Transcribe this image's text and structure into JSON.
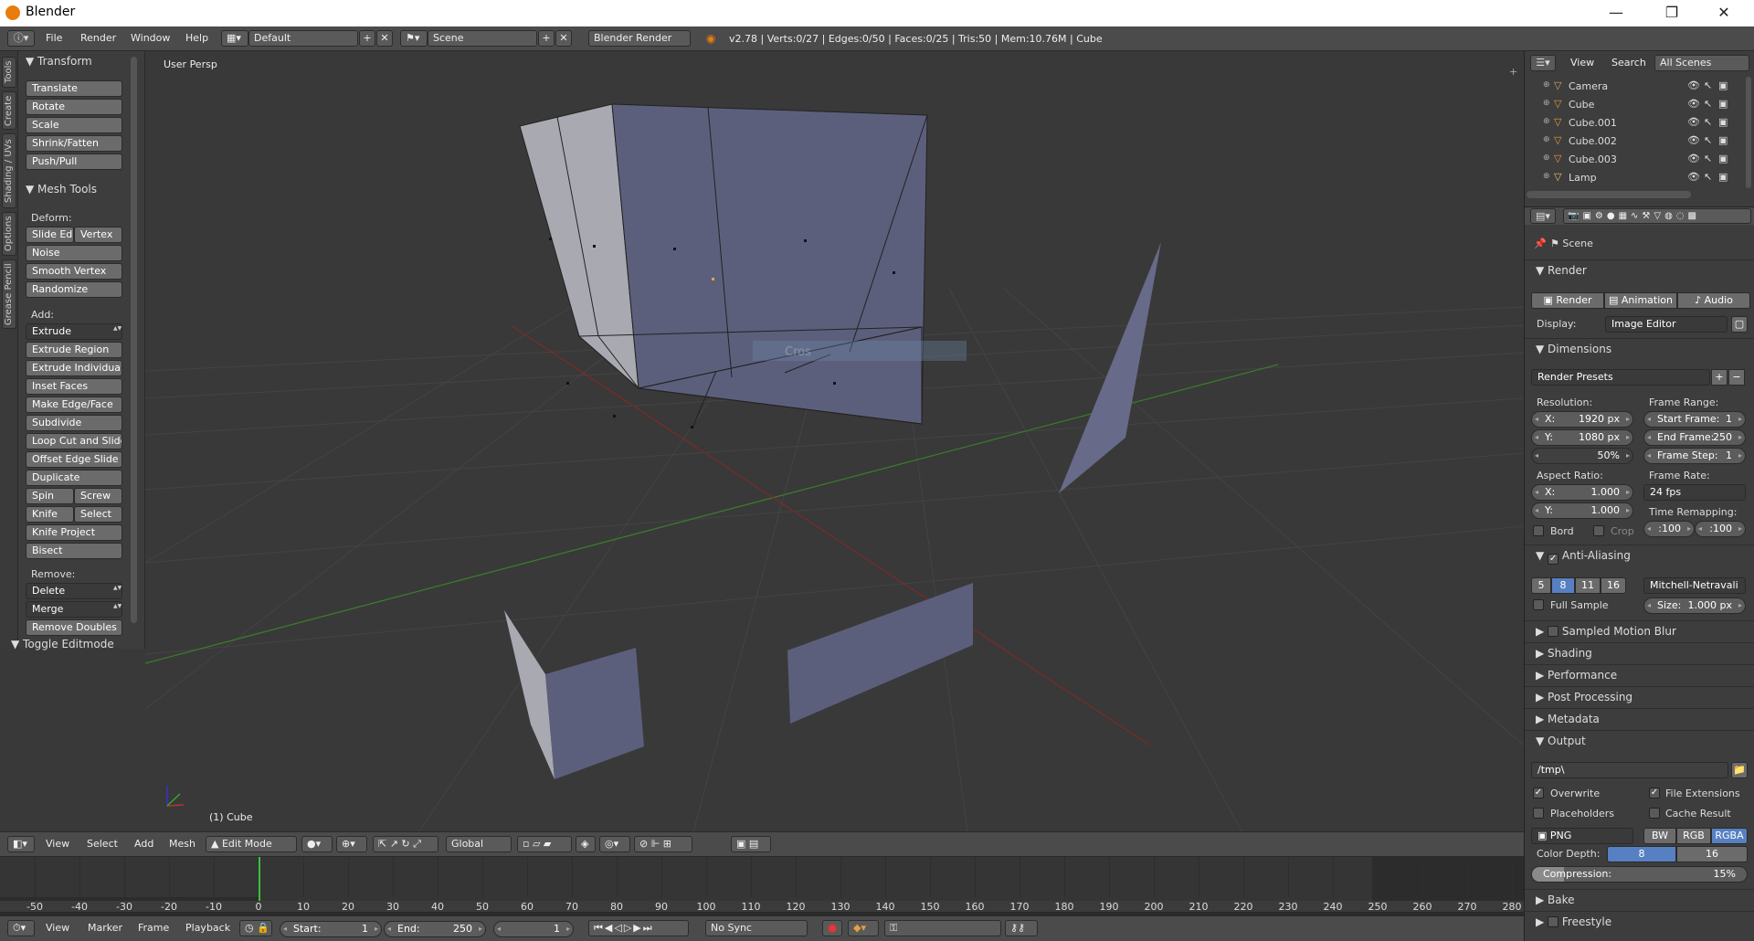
{
  "window": {
    "title": "Blender",
    "minimize": "—",
    "maximize": "❐",
    "close": "✕"
  },
  "infobar": {
    "menus": [
      "File",
      "Render",
      "Window",
      "Help"
    ],
    "layout": "Default",
    "scene": "Scene",
    "engine": "Blender Render",
    "stats": "v2.78 | Verts:0/27 | Edges:0/50 | Faces:0/25 | Tris:50 | Mem:10.76M | Cube"
  },
  "vtabs": [
    "Tools",
    "Create",
    "Shading / UVs",
    "Options",
    "Grease Pencil"
  ],
  "toolshelf": {
    "transform_header": "Transform",
    "transform": [
      "Translate",
      "Rotate",
      "Scale",
      "Shrink/Fatten",
      "Push/Pull"
    ],
    "mesh_header": "Mesh Tools",
    "deform_label": "Deform:",
    "slide_edge": "Slide Ed",
    "vertex": "Vertex",
    "deform": [
      "Noise",
      "Smooth Vertex",
      "Randomize"
    ],
    "add_label": "Add:",
    "extrude": "Extrude",
    "add": [
      "Extrude Region",
      "Extrude Individual",
      "Inset Faces",
      "Make Edge/Face",
      "Subdivide",
      "Loop Cut and Slide",
      "Offset Edge Slide",
      "Duplicate"
    ],
    "spin": "Spin",
    "screw": "Screw",
    "knife": "Knife",
    "select": "Select",
    "knife_project": "Knife Project",
    "bisect": "Bisect",
    "remove_label": "Remove:",
    "delete": "Delete",
    "merge": "Merge",
    "remove_doubles": "Remove Doubles",
    "toggle_editmode": "Toggle Editmode"
  },
  "viewport": {
    "view_label": "User Persp",
    "object_label": "(1) Cube",
    "ghost_label": "Cros"
  },
  "vp_header": {
    "menus": [
      "View",
      "Select",
      "Add",
      "Mesh"
    ],
    "mode": "Edit Mode",
    "orientation": "Global"
  },
  "timeline": {
    "ticks": [
      "-50",
      "-40",
      "-30",
      "-20",
      "-10",
      "0",
      "10",
      "20",
      "30",
      "40",
      "50",
      "60",
      "70",
      "80",
      "90",
      "100",
      "110",
      "120",
      "130",
      "140",
      "150",
      "160",
      "170",
      "180",
      "190",
      "200",
      "210",
      "220",
      "230",
      "240",
      "250",
      "260",
      "270",
      "280"
    ],
    "current_frame_marker": 0,
    "menus": [
      "View",
      "Marker",
      "Frame",
      "Playback"
    ],
    "start_label": "Start:",
    "start": "1",
    "end_label": "End:",
    "end": "250",
    "current": "1",
    "sync": "No Sync"
  },
  "outliner": {
    "menus": [
      "View",
      "Search"
    ],
    "filter": "All Scenes",
    "items": [
      {
        "name": "Camera",
        "color": "#d8a070"
      },
      {
        "name": "Cube",
        "color": "#e89a3c"
      },
      {
        "name": "Cube.001",
        "color": "#e89a3c"
      },
      {
        "name": "Cube.002",
        "color": "#e89a3c"
      },
      {
        "name": "Cube.003",
        "color": "#e89a3c"
      },
      {
        "name": "Lamp",
        "color": "#e8c070"
      }
    ]
  },
  "props": {
    "scene": "Scene",
    "render_header": "Render",
    "render_btn": "Render",
    "animation_btn": "Animation",
    "audio_btn": "Audio",
    "display_label": "Display:",
    "display": "Image Editor",
    "dimensions_header": "Dimensions",
    "presets": "Render Presets",
    "resolution_label": "Resolution:",
    "res_x_l": "X:",
    "res_x": "1920 px",
    "res_y_l": "Y:",
    "res_y": "1080 px",
    "res_pct": "50%",
    "frame_range_label": "Frame Range:",
    "start_l": "Start Frame:",
    "start": "1",
    "end_l": "End Frame:",
    "end": "250",
    "step_l": "Frame Step:",
    "step": "1",
    "aspect_label": "Aspect Ratio:",
    "asp_x_l": "X:",
    "asp_x": "1.000",
    "asp_y_l": "Y:",
    "asp_y": "1.000",
    "frame_rate_label": "Frame Rate:",
    "fps": "24 fps",
    "time_remap_label": "Time Remapping:",
    "remap_old": ":100",
    "remap_new": ":100",
    "bord": "Bord",
    "crop": "Crop",
    "aa_header": "Anti-Aliasing",
    "aa_samples": [
      "5",
      "8",
      "11",
      "16"
    ],
    "aa_selected": "8",
    "filter": "Mitchell-Netravali",
    "full_sample": "Full Sample",
    "size_l": "Size:",
    "size": "1.000 px",
    "smb": "Sampled Motion Blur",
    "collapsed": [
      "Shading",
      "Performance",
      "Post Processing",
      "Metadata"
    ],
    "output_header": "Output",
    "path": "/tmp\\",
    "overwrite": "Overwrite",
    "file_ext": "File Extensions",
    "placeholders": "Placeholders",
    "cache_result": "Cache Result",
    "format": "PNG",
    "bw": "BW",
    "rgb": "RGB",
    "rgba": "RGBA",
    "depth_label": "Color Depth:",
    "depth8": "8",
    "depth16": "16",
    "compression_l": "Compression:",
    "compression": "15%",
    "bake": "Bake",
    "freestyle": "Freestyle"
  }
}
